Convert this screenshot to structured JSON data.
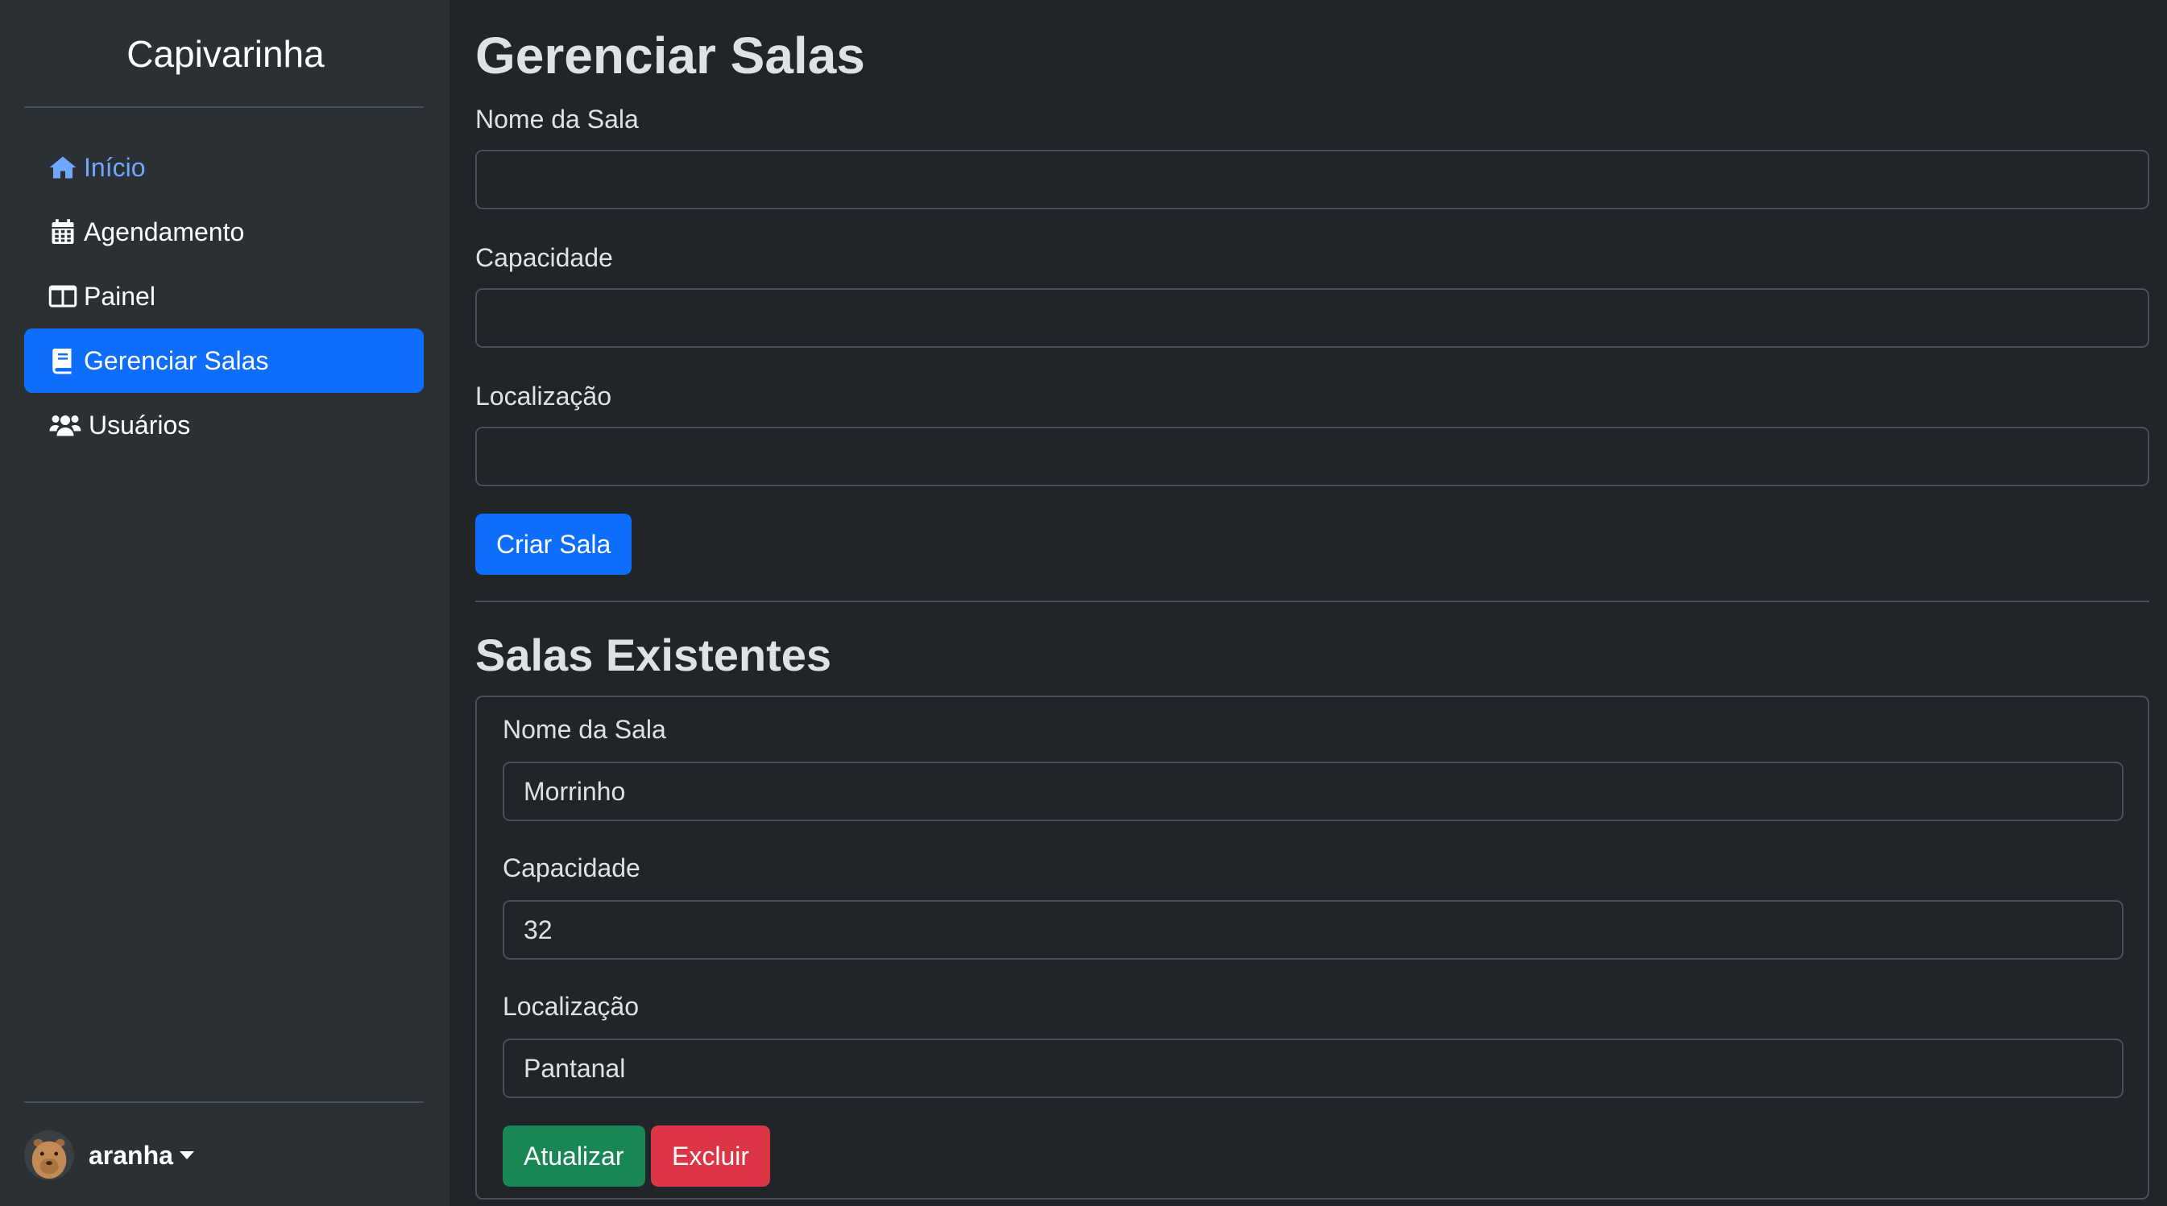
{
  "sidebar": {
    "brand": "Capivarinha",
    "items": [
      {
        "label": "Início",
        "icon": "home-icon"
      },
      {
        "label": "Agendamento",
        "icon": "calendar-icon"
      },
      {
        "label": "Painel",
        "icon": "panel-icon"
      },
      {
        "label": "Gerenciar Salas",
        "icon": "book-icon",
        "active": true
      },
      {
        "label": "Usuários",
        "icon": "users-icon"
      }
    ],
    "user": {
      "name": "aranha",
      "avatar_icon": "capybara-avatar-icon"
    }
  },
  "main": {
    "title": "Gerenciar Salas",
    "create_form": {
      "name_label": "Nome da Sala",
      "name_value": "",
      "capacity_label": "Capacidade",
      "capacity_value": "",
      "location_label": "Localização",
      "location_value": "",
      "submit_label": "Criar Sala"
    },
    "existing_title": "Salas Existentes",
    "rooms": [
      {
        "name_label": "Nome da Sala",
        "name_value": "Morrinho",
        "capacity_label": "Capacidade",
        "capacity_value": "32",
        "location_label": "Localização",
        "location_value": "Pantanal",
        "update_label": "Atualizar",
        "delete_label": "Excluir"
      }
    ]
  },
  "colors": {
    "background": "#212529",
    "sidebar": "#2b3035",
    "primary": "#0d6efd",
    "link": "#6ea8fe",
    "success": "#198754",
    "danger": "#dc3545",
    "border": "#495057"
  }
}
